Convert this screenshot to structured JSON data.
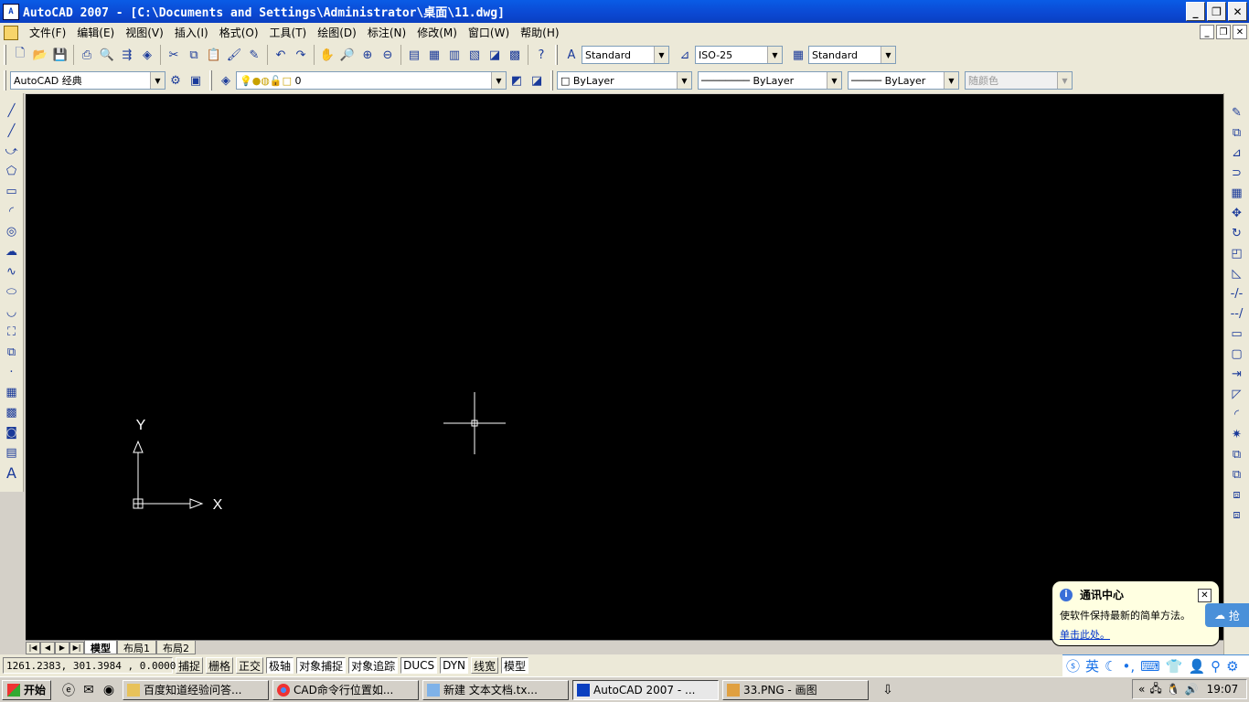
{
  "window": {
    "title": "AutoCAD 2007 - [C:\\Documents and Settings\\Administrator\\桌面\\11.dwg]",
    "icon_text": "A"
  },
  "window_buttons": {
    "minimize": "_",
    "restore": "❐",
    "close": "✕"
  },
  "menu": {
    "items": [
      "文件(F)",
      "编辑(E)",
      "视图(V)",
      "插入(I)",
      "格式(O)",
      "工具(T)",
      "绘图(D)",
      "标注(N)",
      "修改(M)",
      "窗口(W)",
      "帮助(H)"
    ]
  },
  "toolbar1": {
    "text_style": "Standard",
    "dim_style": "ISO-25",
    "table_style": "Standard",
    "icons": [
      "new-icon",
      "open-icon",
      "save-icon",
      "print-icon",
      "preview-icon",
      "publish-icon",
      "3d-publish-icon",
      "cut-icon",
      "copy-icon",
      "paste-icon",
      "match-icon",
      "block-icon",
      "undo-icon",
      "redo-icon",
      "pan-icon",
      "zoom-realtime-icon",
      "zoom-window-icon",
      "zoom-previous-icon",
      "properties-icon",
      "design-center-icon",
      "tool-palette-icon",
      "sheet-set-icon",
      "markup-icon",
      "quick-calc-icon",
      "help-icon"
    ]
  },
  "toolbar2": {
    "workspace": "AutoCAD 经典",
    "layer": "0",
    "color": "ByLayer",
    "linetype": "ByLayer",
    "lineweight": "ByLayer",
    "plot_style": "随颜色"
  },
  "left_tools": [
    "line-icon",
    "construction-line-icon",
    "polyline-icon",
    "polygon-icon",
    "rectangle-icon",
    "arc-icon",
    "circle-icon",
    "revcloud-icon",
    "spline-icon",
    "ellipse-icon",
    "ellipse-arc-icon",
    "insert-block-icon",
    "make-block-icon",
    "point-icon",
    "hatch-icon",
    "gradient-icon",
    "region-icon",
    "table-icon",
    "mtext-icon"
  ],
  "left_tools_glyphs": [
    "╱",
    "╱",
    "⤻",
    "⬠",
    "▭",
    "◜",
    "◎",
    "☁",
    "∿",
    "⬭",
    "◡",
    "⛶",
    "⧉",
    "·",
    "▦",
    "▩",
    "◙",
    "▤",
    "A"
  ],
  "right_tools": [
    "erase-icon",
    "copy-icon",
    "mirror-icon",
    "offset-icon",
    "array-icon",
    "move-icon",
    "rotate-icon",
    "scale-icon",
    "stretch-icon",
    "trim-icon",
    "extend-icon",
    "break-at-point-icon",
    "break-icon",
    "join-icon",
    "chamfer-icon",
    "fillet-icon",
    "explode-icon",
    "draworder-front-icon",
    "draworder-back-icon",
    "draworder-above-icon",
    "draworder-below-icon"
  ],
  "right_tools_glyphs": [
    "✎",
    "⧉",
    "⊿",
    "⊃",
    "▦",
    "✥",
    "↻",
    "◰",
    "◺",
    "-/-",
    "--/",
    "▭",
    "▢",
    "⇥",
    "◸",
    "◜",
    "✷",
    "⧉",
    "⧉",
    "⧈",
    "⧈"
  ],
  "ucs": {
    "x_label": "X",
    "y_label": "Y"
  },
  "layout_tabs": {
    "nav": [
      "|◀",
      "◀",
      "▶",
      "▶|"
    ],
    "tabs": [
      "模型",
      "布局1",
      "布局2"
    ]
  },
  "status": {
    "coords": "1261.2383, 301.3984 , 0.0000",
    "buttons": [
      {
        "label": "捕捉",
        "on": false
      },
      {
        "label": "栅格",
        "on": false
      },
      {
        "label": "正交",
        "on": false
      },
      {
        "label": "极轴",
        "on": true
      },
      {
        "label": "对象捕捉",
        "on": true
      },
      {
        "label": "对象追踪",
        "on": true
      },
      {
        "label": "DUCS",
        "on": true
      },
      {
        "label": "DYN",
        "on": true
      },
      {
        "label": "线宽",
        "on": false
      },
      {
        "label": "模型",
        "on": true
      }
    ]
  },
  "ime": {
    "lang": "英",
    "icons": [
      "moon-icon",
      "punct-icon",
      "keyboard-icon",
      "skin-icon",
      "user-icon",
      "search-icon",
      "settings-icon"
    ]
  },
  "balloon": {
    "title": "通讯中心",
    "text": "使软件保持最新的简单方法。",
    "link": "单击此处。",
    "close": "✕",
    "side_button": "抢"
  },
  "taskbar": {
    "start": "开始",
    "tasks": [
      {
        "label": "百度知道经验问答...",
        "active": false
      },
      {
        "label": "CAD命令行位置如...",
        "active": false
      },
      {
        "label": "新建 文本文档.tx...",
        "active": false
      },
      {
        "label": "AutoCAD 2007 - ...",
        "active": true
      },
      {
        "label": "33.PNG - 画图",
        "active": false
      }
    ],
    "tray_expand": "«",
    "clock": "19:07"
  },
  "colors": {
    "canvas": "#000000",
    "titlebar": "#0b48d2",
    "crosshair": "#ffffff"
  }
}
